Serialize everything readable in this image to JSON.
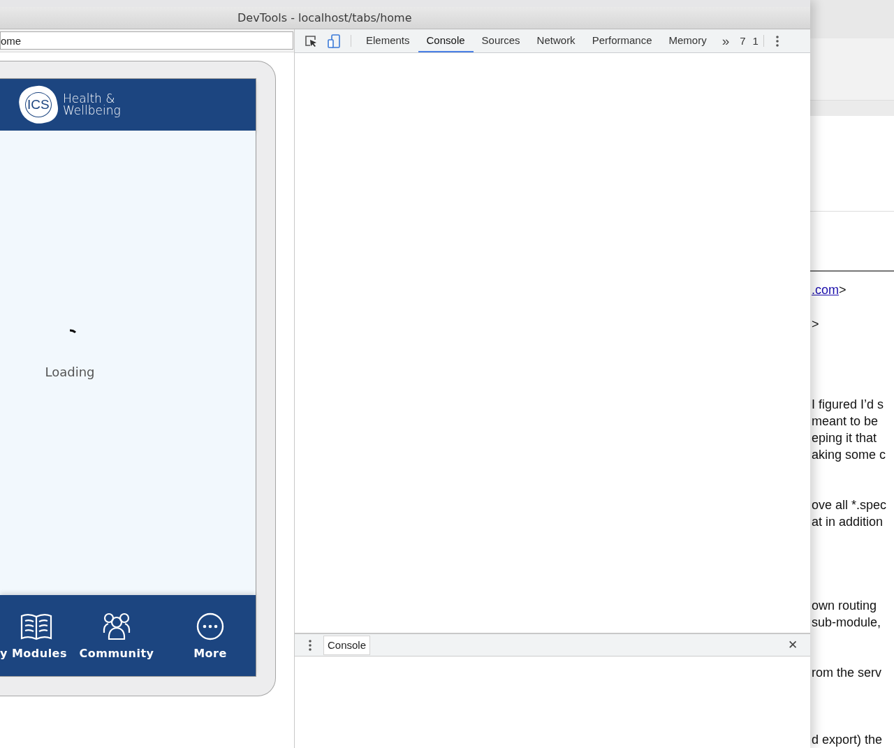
{
  "window": {
    "title": "DevTools - localhost/tabs/home"
  },
  "device_toolbar": {
    "url": "ome"
  },
  "app": {
    "logo": {
      "mark": "ICS",
      "line_1": "Health &",
      "line_2": "Wellbeing"
    },
    "loading_text": "Loading",
    "tabs": [
      {
        "label": "y Modules",
        "kind": "book"
      },
      {
        "label": "Community",
        "kind": "people"
      },
      {
        "label": "More",
        "kind": "more"
      }
    ]
  },
  "devtools": {
    "tabs": [
      {
        "label": "Elements",
        "selected": false
      },
      {
        "label": "Console",
        "selected": true
      },
      {
        "label": "Sources",
        "selected": false
      },
      {
        "label": "Network",
        "selected": false
      },
      {
        "label": "Performance",
        "selected": false
      },
      {
        "label": "Memory",
        "selected": false
      }
    ],
    "overflow": "»",
    "counts": [
      "7",
      "1"
    ],
    "drawer": {
      "tabs": [
        {
          "label": "Console",
          "selected": true
        }
      ],
      "close": "✕"
    }
  },
  "background_page": {
    "paragraphs": [
      {
        "lines": [
          {
            "link": ".com",
            "text": ">"
          }
        ]
      },
      {
        "lines": [
          {
            "text": ">"
          }
        ]
      },
      {
        "lines": [
          {
            "text": "I figured I’d s"
          },
          {
            "text": "meant to be"
          },
          {
            "text": "eping it that"
          },
          {
            "text": "aking some c"
          }
        ]
      },
      {
        "lines": [
          {
            "text": "ove all *.spec"
          },
          {
            "text": "at in addition"
          }
        ]
      },
      {
        "lines": [
          {
            "text": "own routing"
          },
          {
            "text": "sub-module,"
          }
        ]
      },
      {
        "lines": [
          {
            "text": "rom the serv"
          }
        ]
      },
      {
        "lines": [
          {
            "text": "d export) the"
          }
        ]
      }
    ]
  }
}
